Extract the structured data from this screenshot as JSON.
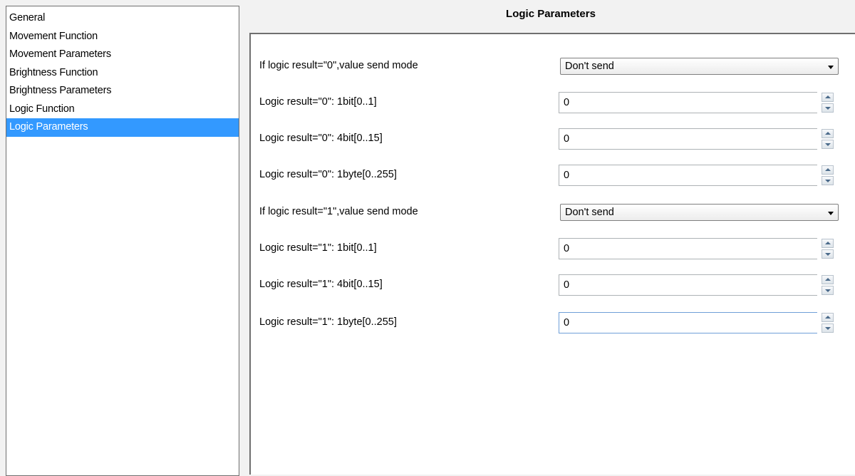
{
  "sidebar": {
    "items": [
      {
        "label": "General"
      },
      {
        "label": "Movement Function"
      },
      {
        "label": "Movement Parameters"
      },
      {
        "label": "Brightness Function"
      },
      {
        "label": "Brightness Parameters"
      },
      {
        "label": "Logic Function"
      },
      {
        "label": "Logic Parameters",
        "selected": true
      }
    ]
  },
  "header": {
    "title": "Logic Parameters"
  },
  "params": {
    "row0": {
      "label": "If logic result=\"0\",value send mode",
      "value": "Don't send"
    },
    "row1": {
      "label": "Logic result=\"0\": 1bit[0..1]",
      "value": "0"
    },
    "row2": {
      "label": "Logic result=\"0\": 4bit[0..15]",
      "value": "0"
    },
    "row3": {
      "label": "Logic result=\"0\": 1byte[0..255]",
      "value": "0"
    },
    "row4": {
      "label": "If logic result=\"1\",value send mode",
      "value": "Don't send"
    },
    "row5": {
      "label": "Logic result=\"1\": 1bit[0..1]",
      "value": "0"
    },
    "row6": {
      "label": "Logic result=\"1\": 4bit[0..15]",
      "value": "0"
    },
    "row7": {
      "label": "Logic result=\"1\": 1byte[0..255]",
      "value": "0"
    }
  },
  "icons": {
    "dropdown": "chevron-down-icon",
    "spin_up": "arrow-up-icon",
    "spin_down": "arrow-down-icon"
  },
  "colors": {
    "selection": "#3399ff",
    "panel_bg": "#f2f2f2"
  }
}
